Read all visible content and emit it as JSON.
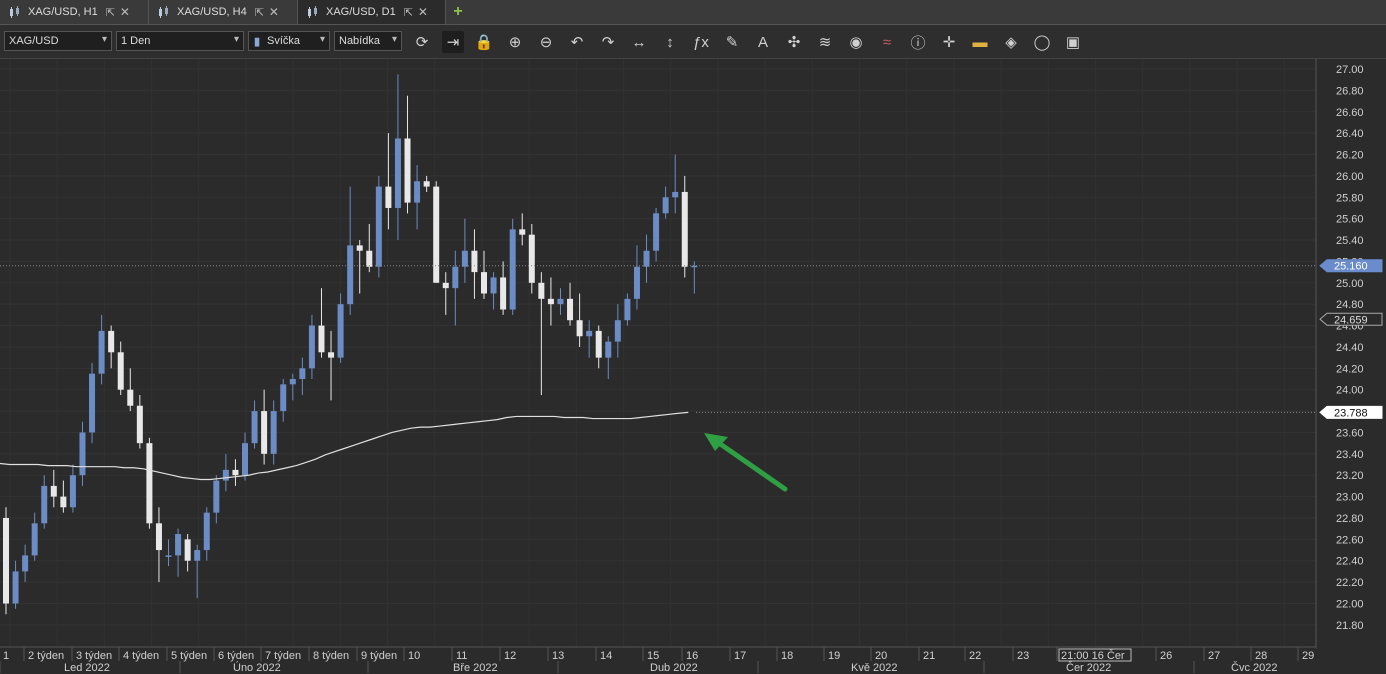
{
  "tabs": [
    {
      "label": "XAG/USD, H1",
      "active": false
    },
    {
      "label": "XAG/USD, H4",
      "active": false
    },
    {
      "label": "XAG/USD, D1",
      "active": true
    }
  ],
  "toolbar": {
    "symbol": "XAG/USD",
    "period": "1 Den",
    "chart_type": "Svíčka",
    "menu": "Nabídka",
    "icons": [
      "refresh-icon",
      "autoscroll-icon",
      "lock-icon",
      "zoom-in-icon",
      "zoom-out-icon",
      "undo-icon",
      "redo-icon",
      "horizontal-scale-icon",
      "vertical-scale-icon",
      "indicators-icon",
      "pencil-icon",
      "text-icon",
      "objects-icon",
      "layers-icon",
      "eye-icon",
      "signals-icon",
      "info-icon",
      "crosshair-icon",
      "colors-icon",
      "fill-icon",
      "circle-icon",
      "save-icon"
    ]
  },
  "price_axis": {
    "ticks": [
      "27.00",
      "26.80",
      "26.60",
      "26.40",
      "26.20",
      "26.00",
      "25.80",
      "25.60",
      "25.40",
      "25.20",
      "25.00",
      "24.80",
      "24.60",
      "24.40",
      "24.20",
      "24.00",
      "23.80",
      "23.60",
      "23.40",
      "23.20",
      "23.00",
      "22.80",
      "22.60",
      "22.40",
      "22.20",
      "22.00",
      "21.80"
    ],
    "labels": [
      {
        "text": "25.160",
        "value": 25.16,
        "style": "blue"
      },
      {
        "text": "24.659",
        "value": 24.659,
        "style": "gray"
      },
      {
        "text": "23.788",
        "value": 23.788,
        "style": "white"
      }
    ]
  },
  "time_axis": {
    "top_labels": [
      "1",
      "2 týden",
      "3 týden",
      "4 týden",
      "5 týden",
      "6 týden",
      "7 týden",
      "8 týden",
      "9 týden",
      "10",
      "11",
      "12",
      "13",
      "14",
      "15",
      "16",
      "17",
      "18",
      "19",
      "20",
      "21",
      "22",
      "23",
      "21:00 16 Čer",
      "26",
      "27",
      "28",
      "29"
    ],
    "bottom_labels": [
      "Led 2022",
      "Úno 2022",
      "Bře 2022",
      "Dub 2022",
      "Kvě 2022",
      "Čer 2022",
      "Čvc 2022"
    ]
  },
  "chart_data": {
    "type": "candlestick",
    "symbol": "XAG/USD",
    "timeframe": "D1",
    "ylim": [
      21.8,
      27.05
    ],
    "bull_color": "#6b8cc4",
    "bear_color": "#e8e8e8",
    "ma_color": "#e0e0e0",
    "candles": [
      [
        22.8,
        22.9,
        21.9,
        22.0
      ],
      [
        22.0,
        22.4,
        21.95,
        22.3
      ],
      [
        22.3,
        22.55,
        22.2,
        22.45
      ],
      [
        22.45,
        22.85,
        22.4,
        22.75
      ],
      [
        22.75,
        23.2,
        22.7,
        23.1
      ],
      [
        23.1,
        23.25,
        22.9,
        23.0
      ],
      [
        23.0,
        23.15,
        22.85,
        22.9
      ],
      [
        22.9,
        23.3,
        22.85,
        23.2
      ],
      [
        23.2,
        23.7,
        23.1,
        23.6
      ],
      [
        23.6,
        24.25,
        23.5,
        24.15
      ],
      [
        24.15,
        24.7,
        24.05,
        24.55
      ],
      [
        24.55,
        24.6,
        24.2,
        24.35
      ],
      [
        24.35,
        24.45,
        23.95,
        24.0
      ],
      [
        24.0,
        24.2,
        23.8,
        23.85
      ],
      [
        23.85,
        23.95,
        23.45,
        23.5
      ],
      [
        23.5,
        23.55,
        22.7,
        22.75
      ],
      [
        22.75,
        22.9,
        22.2,
        22.5
      ],
      [
        22.45,
        22.6,
        22.35,
        22.45
      ],
      [
        22.45,
        22.7,
        22.25,
        22.65
      ],
      [
        22.6,
        22.65,
        22.3,
        22.4
      ],
      [
        22.4,
        22.55,
        22.05,
        22.5
      ],
      [
        22.5,
        22.9,
        22.4,
        22.85
      ],
      [
        22.85,
        23.2,
        22.75,
        23.15
      ],
      [
        23.15,
        23.4,
        23.05,
        23.25
      ],
      [
        23.25,
        23.35,
        23.1,
        23.2
      ],
      [
        23.2,
        23.6,
        23.15,
        23.5
      ],
      [
        23.5,
        23.9,
        23.45,
        23.8
      ],
      [
        23.8,
        24.0,
        23.3,
        23.4
      ],
      [
        23.4,
        23.9,
        23.3,
        23.8
      ],
      [
        23.8,
        24.1,
        23.7,
        24.05
      ],
      [
        24.05,
        24.15,
        23.9,
        24.1
      ],
      [
        24.1,
        24.3,
        23.95,
        24.2
      ],
      [
        24.2,
        24.7,
        24.1,
        24.6
      ],
      [
        24.6,
        24.95,
        24.3,
        24.35
      ],
      [
        24.35,
        24.55,
        23.9,
        24.3
      ],
      [
        24.3,
        24.9,
        24.25,
        24.8
      ],
      [
        24.8,
        25.9,
        24.7,
        25.35
      ],
      [
        25.35,
        25.4,
        24.9,
        25.3
      ],
      [
        25.3,
        25.55,
        25.1,
        25.15
      ],
      [
        25.15,
        26.0,
        25.05,
        25.9
      ],
      [
        25.9,
        26.4,
        25.5,
        25.7
      ],
      [
        25.7,
        26.95,
        25.4,
        26.35
      ],
      [
        26.35,
        26.75,
        25.65,
        25.75
      ],
      [
        25.75,
        26.1,
        25.5,
        25.95
      ],
      [
        25.95,
        26.0,
        25.85,
        25.9
      ],
      [
        25.9,
        25.95,
        25.0,
        25.0
      ],
      [
        25.0,
        25.1,
        24.7,
        24.95
      ],
      [
        24.95,
        25.3,
        24.6,
        25.15
      ],
      [
        25.15,
        25.6,
        25.0,
        25.3
      ],
      [
        25.3,
        25.5,
        24.85,
        25.1
      ],
      [
        25.1,
        25.3,
        24.85,
        24.9
      ],
      [
        24.9,
        25.1,
        24.75,
        25.05
      ],
      [
        25.05,
        25.2,
        24.7,
        24.75
      ],
      [
        24.75,
        25.6,
        24.7,
        25.5
      ],
      [
        25.5,
        25.65,
        25.35,
        25.45
      ],
      [
        25.45,
        25.55,
        24.9,
        25.0
      ],
      [
        25.0,
        25.1,
        23.95,
        24.85
      ],
      [
        24.85,
        25.05,
        24.6,
        24.8
      ],
      [
        24.8,
        24.95,
        24.7,
        24.85
      ],
      [
        24.85,
        25.0,
        24.6,
        24.65
      ],
      [
        24.65,
        24.9,
        24.4,
        24.5
      ],
      [
        24.5,
        24.65,
        24.3,
        24.55
      ],
      [
        24.55,
        24.6,
        24.2,
        24.3
      ],
      [
        24.3,
        24.5,
        24.1,
        24.45
      ],
      [
        24.45,
        24.8,
        24.3,
        24.65
      ],
      [
        24.65,
        24.9,
        24.6,
        24.85
      ],
      [
        24.85,
        25.35,
        24.75,
        25.15
      ],
      [
        25.15,
        25.45,
        25.0,
        25.3
      ],
      [
        25.3,
        25.7,
        25.2,
        25.65
      ],
      [
        25.65,
        25.9,
        25.6,
        25.8
      ],
      [
        25.8,
        26.2,
        25.65,
        25.85
      ],
      [
        25.85,
        26.0,
        25.05,
        25.15
      ],
      [
        25.15,
        25.2,
        24.9,
        25.16
      ]
    ],
    "moving_average": [
      23.31,
      23.3,
      23.3,
      23.3,
      23.3,
      23.29,
      23.29,
      23.29,
      23.28,
      23.28,
      23.28,
      23.28,
      23.28,
      23.27,
      23.27,
      23.26,
      23.24,
      23.22,
      23.2,
      23.18,
      23.17,
      23.16,
      23.16,
      23.17,
      23.18,
      23.19,
      23.2,
      23.22,
      23.23,
      23.25,
      23.27,
      23.29,
      23.32,
      23.35,
      23.39,
      23.42,
      23.45,
      23.48,
      23.51,
      23.54,
      23.57,
      23.6,
      23.62,
      23.64,
      23.65,
      23.65,
      23.66,
      23.67,
      23.68,
      23.69,
      23.7,
      23.71,
      23.72,
      23.74,
      23.75,
      23.75,
      23.75,
      23.75,
      23.75,
      23.74,
      23.74,
      23.74,
      23.73,
      23.73,
      23.73,
      23.73,
      23.73,
      23.74,
      23.75,
      23.76,
      23.77,
      23.78,
      23.788
    ]
  }
}
